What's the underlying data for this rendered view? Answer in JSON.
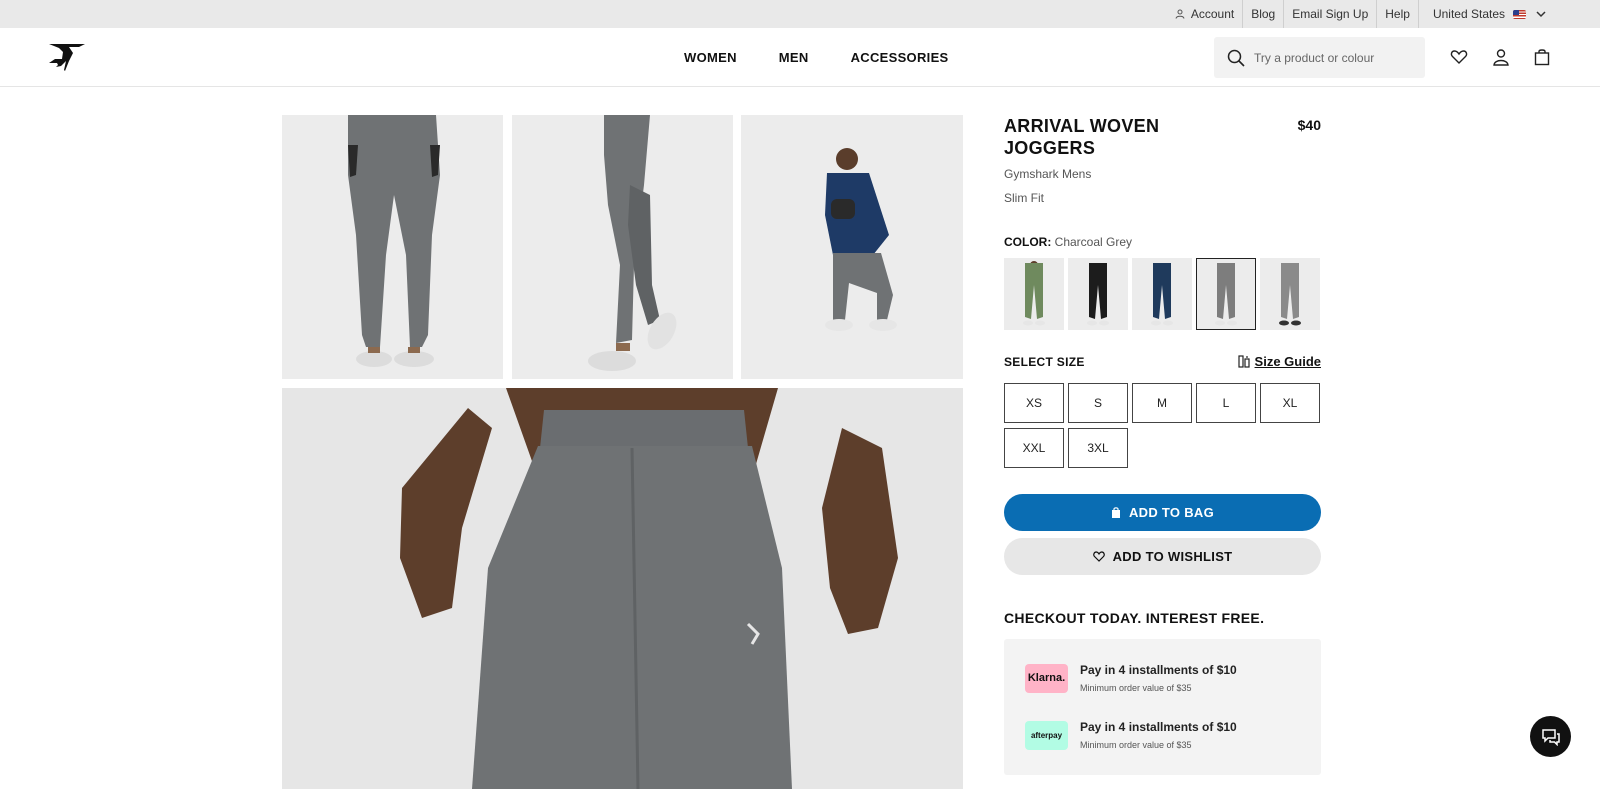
{
  "utility": {
    "account": "Account",
    "blog": "Blog",
    "email_signup": "Email Sign Up",
    "help": "Help",
    "country": "United States"
  },
  "header": {
    "nav": [
      "WOMEN",
      "MEN",
      "ACCESSORIES"
    ],
    "search_placeholder": "Try a product or colour"
  },
  "product": {
    "title": "ARRIVAL WOVEN JOGGERS",
    "price": "$40",
    "brand_line": "Gymshark Mens",
    "fit": "Slim Fit",
    "color_label": "COLOR:",
    "color_value": "Charcoal Grey",
    "swatch_colors": [
      "#6f8a5e",
      "#1c1c1c",
      "#1f3a5c",
      "#7d7d7d",
      "#8a8a8a"
    ],
    "selected_swatch": "Charcoal Grey",
    "size_label": "SELECT SIZE",
    "size_guide": "Size Guide",
    "sizes": [
      "XS",
      "S",
      "M",
      "L",
      "XL",
      "XXL",
      "3XL"
    ],
    "add_to_bag": "ADD TO BAG",
    "add_to_wishlist": "ADD TO WISHLIST"
  },
  "checkout": {
    "title": "CHECKOUT TODAY. INTEREST FREE.",
    "options": [
      {
        "provider": "Klarna.",
        "text": "Pay in 4 installments of $10",
        "minimum": "Minimum order value of $35"
      },
      {
        "provider": "afterpay",
        "text": "Pay in 4 installments of $10",
        "minimum": "Minimum order value of $35"
      }
    ]
  },
  "colors": {
    "accent_blue": "#0a6db3",
    "utility_bg": "#e9e9e9",
    "klarna_pink": "#ffb3c7",
    "afterpay_mint": "#b2fce4"
  }
}
